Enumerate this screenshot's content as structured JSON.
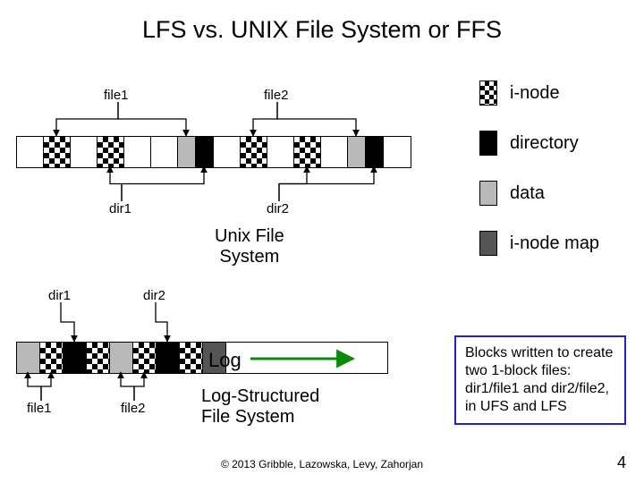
{
  "title": "LFS vs. UNIX File System or FFS",
  "legend": {
    "inode": "i-node",
    "directory": "directory",
    "data": "data",
    "inode_map": "i-node map"
  },
  "ufs_labels": {
    "file1": "file1",
    "file2": "file2",
    "dir1": "dir1",
    "dir2": "dir2"
  },
  "lfs_labels": {
    "file1": "file1",
    "file2": "file2",
    "dir1": "dir1",
    "dir2": "dir2"
  },
  "captions": {
    "unix": "Unix File\nSystem",
    "lfs": "Log-Structured\nFile System",
    "log": "Log"
  },
  "note": "Blocks written to create two 1-block files: dir1/file1 and dir2/file2, in UFS and LFS",
  "copyright": "© 2013 Gribble, Lazowska, Levy, Zahorjan",
  "page": "4",
  "chart_data": {
    "type": "table",
    "title": "Block layout comparison: UNIX File System vs Log-Structured File System",
    "legend_map": {
      "check": "i-node",
      "black": "directory",
      "grey": "data",
      "dark": "i-node map",
      "white": "unused"
    },
    "ufs_row": [
      "white",
      "check",
      "white",
      "check",
      "white",
      "white",
      "grey",
      "black",
      "white",
      "check",
      "white",
      "check",
      "white",
      "grey",
      "black",
      "white"
    ],
    "lfs_row": [
      "grey",
      "check",
      "black",
      "check",
      "grey",
      "check",
      "black",
      "check",
      "dark"
    ],
    "ufs_arrows": [
      {
        "from_label": "file1",
        "to_blocks": [
          1,
          6
        ]
      },
      {
        "from_label": "file2",
        "to_blocks": [
          9,
          13
        ]
      },
      {
        "from_label": "dir1",
        "to_blocks": [
          3,
          7
        ]
      },
      {
        "from_label": "dir2",
        "to_blocks": [
          11,
          14
        ]
      }
    ],
    "lfs_arrows": [
      {
        "from_label": "dir1",
        "to_blocks": [
          2
        ]
      },
      {
        "from_label": "dir2",
        "to_blocks": [
          6
        ]
      },
      {
        "from_label": "file1",
        "to_blocks": [
          0,
          1
        ]
      },
      {
        "from_label": "file2",
        "to_blocks": [
          4,
          5
        ]
      }
    ]
  }
}
